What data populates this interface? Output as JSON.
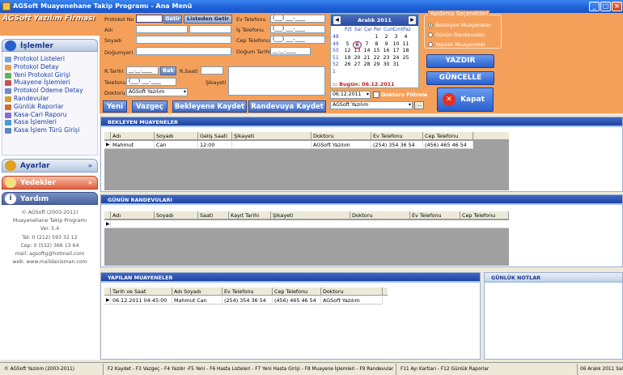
{
  "window": {
    "title": "AGSoft Muayenehane Takip Programı - Ana Menü"
  },
  "brand": "AGSoft Yazılım Firması",
  "sidebar": {
    "islemler_title": "İşlemler",
    "items": [
      "Protokol Listeleri",
      "Protokol Detay",
      "Yeni Protokol Girişi",
      "Muayene İşlemleri",
      "Protokol Ödeme Detay",
      "Randevular",
      "Günlük Raporlar",
      "Kasa-Cari Raporu",
      "Kasa İşlemleri",
      "Kasa İşlem Türü Girişi"
    ],
    "ayarlar": "Ayarlar",
    "yedekler": "Yedekler",
    "yardim": "Yardım",
    "help_lines": [
      "© AGSoft (2003-2011)",
      "Muayenehane Takip Programı",
      "Ver. 5.4",
      "Tel: 0 (212) 593 32 12",
      "Cep: 0 (532) 366 13 64",
      "mail: agsoftg@hotmail.com",
      "web: www.maildanisman.com"
    ]
  },
  "form": {
    "protokol_no": "Protokol No",
    "getir": "Getir",
    "listeden_getir": "Listeden Getir",
    "adi": "Adı",
    "soyadi": "Soyadı",
    "dogumyeri": "Doğumyeri",
    "ev_tel": "Ev Telefonu",
    "is_tel": "İş Telefonu",
    "cep_tel": "Cep Telefonu",
    "dogum_tarihi": "Doğum Tarihi",
    "phone_mask": "(___) ___-____",
    "date_mask": "__.__.____",
    "r_tarihi": "R.Tarihi",
    "bak": "Bak",
    "r_saati": "R.Saati",
    "telefonu": "Telefonu",
    "sikayeti": "Şikayeti",
    "doktoru": "Doktoru",
    "doktor_value": "AGSoft Yazılım"
  },
  "calendar": {
    "month": "Aralık 2011",
    "days": [
      "Pzt",
      "Sal",
      "Çar",
      "Per",
      "Cum",
      "Cmt",
      "Paz"
    ],
    "weeks": [
      "48",
      "49",
      "50",
      "51",
      "52",
      "1"
    ],
    "rows": [
      [
        "",
        "",
        "",
        "1",
        "2",
        "3",
        "4"
      ],
      [
        "5",
        "6",
        "7",
        "8",
        "9",
        "10",
        "11"
      ],
      [
        "12",
        "13",
        "14",
        "15",
        "16",
        "17",
        "18"
      ],
      [
        "19",
        "20",
        "21",
        "22",
        "23",
        "24",
        "25"
      ],
      [
        "26",
        "27",
        "28",
        "29",
        "30",
        "31",
        ""
      ],
      [
        "",
        "",
        "",
        "",
        "",
        "",
        ""
      ]
    ],
    "today_label": "Bugün: 06.12.2011",
    "date_value": "06.12.2011",
    "doktoru_filtrele": "Doktoru Filtrele",
    "doktor_select": "AGSoft Yazılım"
  },
  "print_options": {
    "title": "Yazdırma Seçenekleri",
    "options": [
      "Bekleyen Muayeneler",
      "Günün Randevuları",
      "Yapılan Muayeneler"
    ]
  },
  "buttons": {
    "yazdir": "YAZDIR",
    "guncelle": "GÜNCELLE",
    "kapat": "Kapat",
    "yeni": "Yeni",
    "vazgec": "Vazgeç",
    "bekleyene_kaydet": "Bekleyene Kaydet",
    "randevuya_kaydet": "Randevuya Kaydet"
  },
  "bekleyen": {
    "title": "BEKLEYEN MUAYENELER",
    "columns": [
      "Adı",
      "Soyadı",
      "Geliş Saati",
      "Şikayeti",
      "Doktoru",
      "Ev Telefonu",
      "Cep Telefonu"
    ],
    "rows": [
      [
        "Mahmut",
        "Can",
        "12:00",
        "",
        "AGSoft Yazılım",
        "(254) 354 36 54",
        "(456) 465 46 54"
      ]
    ]
  },
  "randevular": {
    "title": "GÜNÜN RANDEVULARI",
    "columns": [
      "Adı",
      "Soyadı",
      "Saati",
      "Kayıt Tarihi",
      "Şikayeti",
      "Doktoru",
      "Ev Telefonu",
      "Cep Telefonu"
    ]
  },
  "yapilan": {
    "title": "YAPILAN MUAYENELER",
    "columns": [
      "Tarih ve Saat",
      "Adı Soyadı",
      "Ev Telefonu",
      "Cep Telefonu",
      "Doktoru"
    ],
    "rows": [
      [
        "06.12.2011 04:45:00",
        "Mahmut Can",
        "(254) 354 36 54",
        "(456) 465 46 54",
        "AGSoft Yazılım"
      ]
    ]
  },
  "notlar": {
    "title": "GÜNLÜK NOTLAR"
  },
  "status": [
    "© AGSoft Yazılım (2003-2011)",
    "F2 Kaydet - F3 Vazgeç - F4 Yazdır -F5 Yeni - F6 Hasta Listeleri - F7 Yeni Hasta Girişi - F8 Muayene İşlemleri - F9 Randevular",
    "F11 Ayı Kartları - F12 Günlük Raporlar",
    "06 Aralık 2011 Salı"
  ]
}
